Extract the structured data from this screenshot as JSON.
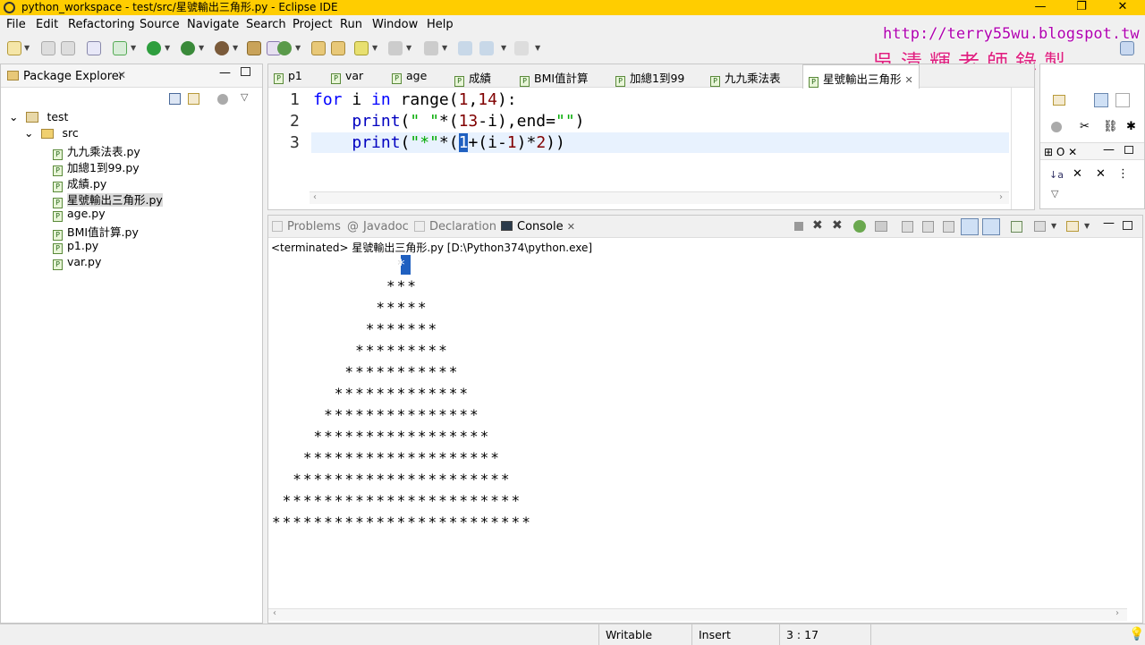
{
  "window": {
    "title": "python_workspace - test/src/星號輸出三角形.py - Eclipse IDE"
  },
  "menu": [
    "File",
    "Edit",
    "Refactoring",
    "Source",
    "Navigate",
    "Search",
    "Project",
    "Run",
    "Window",
    "Help"
  ],
  "watermark": {
    "url": "http://terry55wu.blogspot.tw",
    "name": "吳清輝老師錄製"
  },
  "package_explorer": {
    "title": "Package Explorer",
    "project": "test",
    "folder": "src",
    "files": [
      "九九乘法表.py",
      "加總1到99.py",
      "成績.py",
      "星號輸出三角形.py",
      "age.py",
      "BMI值計算.py",
      "p1.py",
      "var.py"
    ],
    "selected_index": 3
  },
  "editor": {
    "tabs": [
      "p1",
      "var",
      "age",
      "成績",
      "BMI值計算",
      "加總1到99",
      "九九乘法表",
      "星號輸出三角形"
    ],
    "active_tab": 7,
    "line_numbers": [
      "1",
      "2",
      "3"
    ],
    "lines": [
      {
        "parts": [
          "for",
          " i ",
          "in",
          " ",
          "range",
          "(",
          "1",
          ",",
          "14",
          "):"
        ]
      },
      {
        "parts": [
          "    ",
          "print",
          "(",
          "\" \"",
          "*(",
          "13",
          "-i),end=",
          "\"\"",
          ")"
        ]
      },
      {
        "parts": [
          "    ",
          "print",
          "(",
          "\"*\"",
          "*(",
          "1",
          "+(i-",
          "1",
          ")*",
          "2",
          "))"
        ]
      }
    ]
  },
  "console": {
    "tabs": [
      "Problems",
      "Javadoc",
      "Declaration",
      "Console"
    ],
    "active_tab": 3,
    "terminated": "<terminated> 星號輸出三角形.py [D:\\Python374\\python.exe]",
    "output": [
      "            *",
      "           ***",
      "          *****",
      "         *******",
      "        *********",
      "       ***********",
      "      *************",
      "     ***************",
      "    *****************",
      "   *******************",
      "  *********************",
      " ***********************",
      "*************************"
    ]
  },
  "status": {
    "writable": "Writable",
    "insert": "Insert",
    "position": "3 : 17"
  }
}
